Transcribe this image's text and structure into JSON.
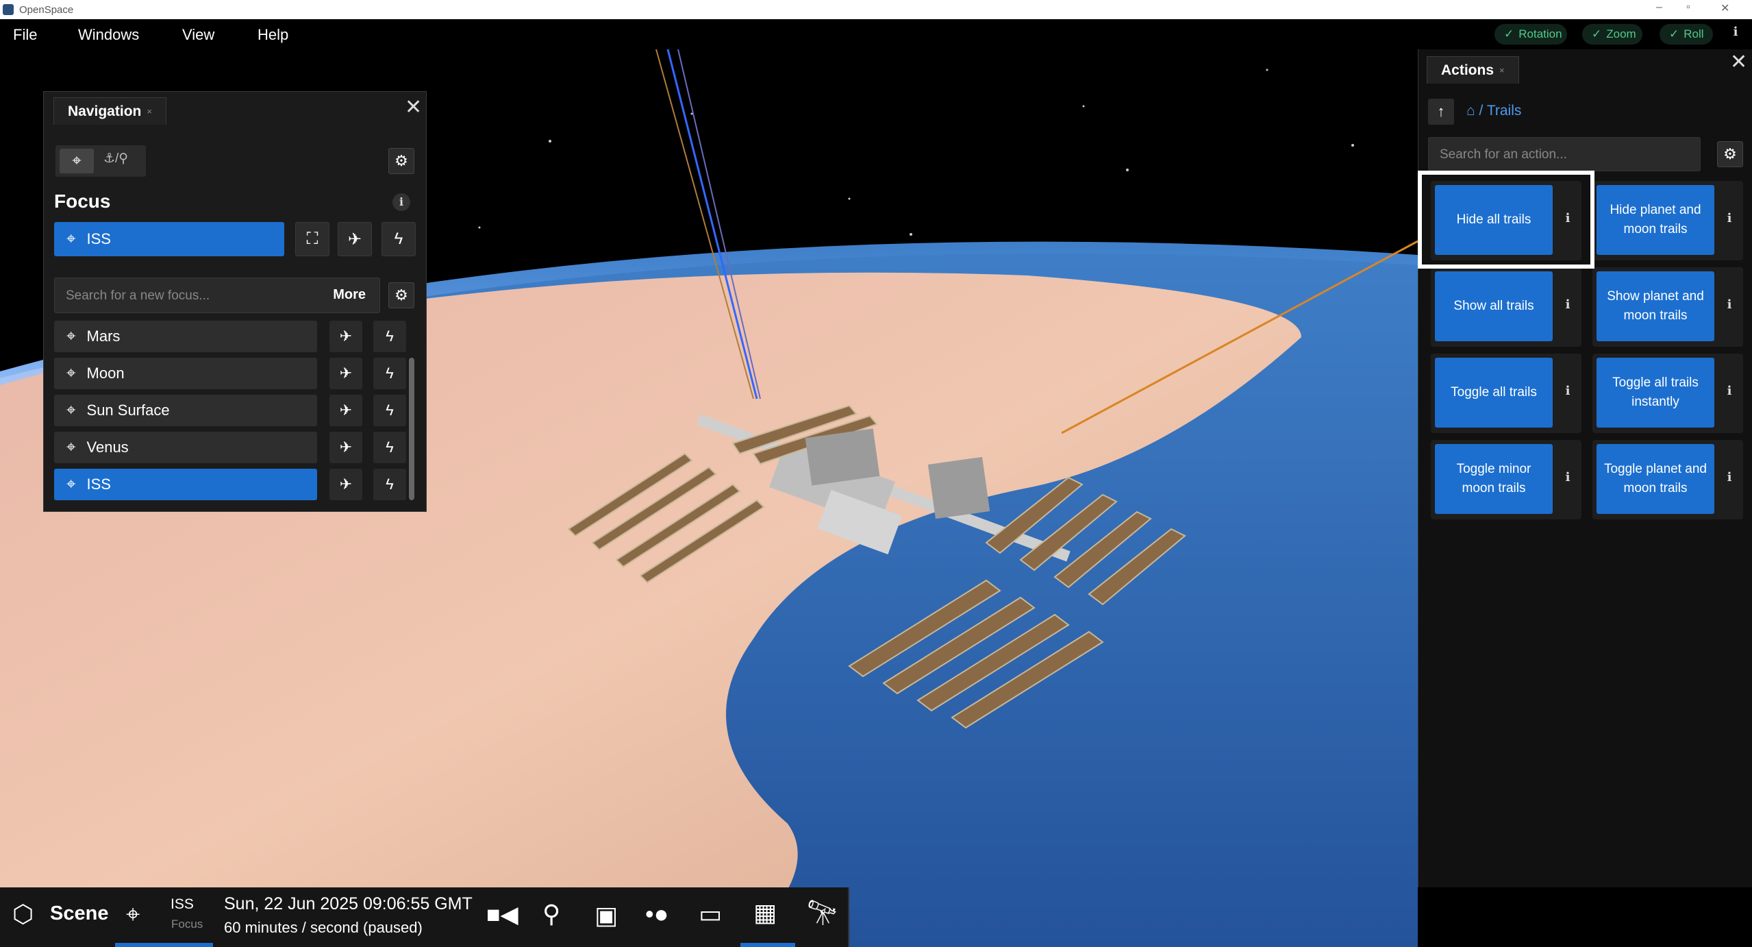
{
  "window": {
    "title": "OpenSpace",
    "minimize": "–",
    "maximize": "▫",
    "close": "✕"
  },
  "menu": [
    "File",
    "Windows",
    "View",
    "Help"
  ],
  "toggles": [
    {
      "label": "Rotation",
      "checked": true
    },
    {
      "label": "Zoom",
      "checked": true
    },
    {
      "label": "Roll",
      "checked": true
    }
  ],
  "info_icon": "i",
  "navigation": {
    "tab_label": "Navigation",
    "focus_heading": "Focus",
    "current_focus": "ISS",
    "search_placeholder": "Search for a new focus...",
    "more_label": "More",
    "mode_b_label": "⚓/⚲",
    "list": [
      {
        "name": "Mars",
        "selected": false
      },
      {
        "name": "Moon",
        "selected": false
      },
      {
        "name": "Sun Surface",
        "selected": false
      },
      {
        "name": "Venus",
        "selected": false
      },
      {
        "name": "ISS",
        "selected": true
      }
    ]
  },
  "actions": {
    "tab_label": "Actions",
    "breadcrumb": "/ Trails",
    "search_placeholder": "Search for an action...",
    "buttons": [
      "Hide all trails",
      "Hide planet and moon trails",
      "Show all trails",
      "Show planet and moon trails",
      "Toggle all trails",
      "Toggle all trails instantly",
      "Toggle minor moon trails",
      "Toggle planet and moon trails"
    ],
    "highlighted": "Hide all trails"
  },
  "bottom_bar": {
    "scene_label": "Scene",
    "focus_object": "ISS",
    "focus_sub": "Focus",
    "time": "Sun, 22 Jun 2025 09:06:55 GMT",
    "rate": "60 minutes / second (paused)"
  },
  "colors": {
    "accent": "#1c6fcf",
    "toggle_green": "#53c989",
    "link": "#4f9bef"
  }
}
